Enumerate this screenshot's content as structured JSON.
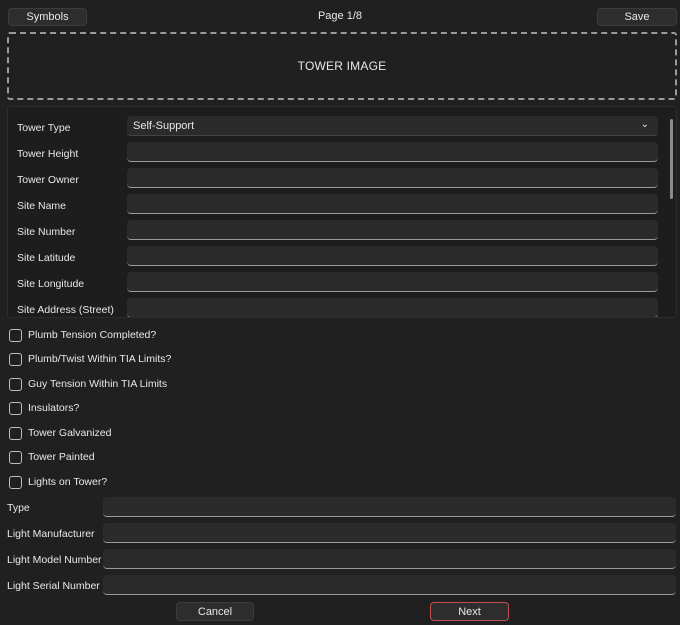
{
  "header": {
    "symbols_label": "Symbols",
    "page_label": "Page 1/8",
    "save_label": "Save"
  },
  "tower_image": {
    "label": "TOWER IMAGE"
  },
  "fields": [
    {
      "label": "Tower Type",
      "value": "Self-Support",
      "kind": "select"
    },
    {
      "label": "Tower Height",
      "value": ""
    },
    {
      "label": "Tower Owner",
      "value": ""
    },
    {
      "label": "Site Name",
      "value": ""
    },
    {
      "label": "Site Number",
      "value": ""
    },
    {
      "label": "Site Latitude",
      "value": ""
    },
    {
      "label": "Site Longitude",
      "value": ""
    },
    {
      "label": "Site Address (Street)",
      "value": ""
    }
  ],
  "checkboxes": [
    {
      "label": "Plumb  Tension Completed?",
      "checked": false
    },
    {
      "label": "Plumb/Twist Within TIA Limits?",
      "checked": false
    },
    {
      "label": "Guy Tension Within TIA Limits",
      "checked": false
    },
    {
      "label": "Insulators?",
      "checked": false
    },
    {
      "label": "Tower Galvanized",
      "checked": false
    },
    {
      "label": "Tower Painted",
      "checked": false
    },
    {
      "label": "Lights on Tower?",
      "checked": false
    }
  ],
  "light_fields": [
    {
      "label": "Type",
      "value": ""
    },
    {
      "label": "Light Manufacturer",
      "value": ""
    },
    {
      "label": "Light Model Number",
      "value": ""
    },
    {
      "label": "Light Serial Number",
      "value": ""
    }
  ],
  "footer": {
    "cancel_label": "Cancel",
    "next_label": "Next"
  },
  "colors": {
    "background": "#202020",
    "input_background": "#2b2b2b",
    "next_border": "#c0504f"
  }
}
